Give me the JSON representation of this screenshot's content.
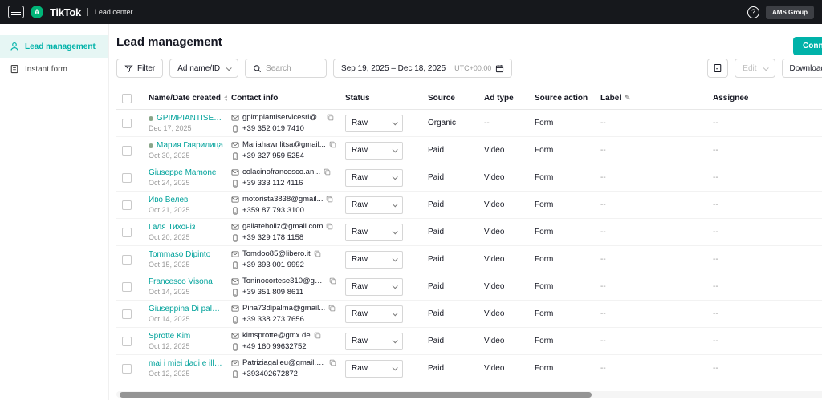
{
  "colors": {
    "accent": "#00b2a9",
    "accent_light_bg": "#e6f6f4",
    "avatar_green": "#00b578",
    "topbar_bg": "#16181c"
  },
  "icons": {
    "help": "?",
    "edit_pencil": "✎"
  },
  "topbar": {
    "brand": "TikTok",
    "product": "Lead center",
    "avatar_letter": "A",
    "org_button_label": "AMS Group"
  },
  "sidebar": {
    "items": [
      {
        "label": "Lead management"
      },
      {
        "label": "Instant form"
      }
    ]
  },
  "main": {
    "title": "Lead management",
    "connect_button_label": "Connect"
  },
  "toolbar": {
    "filter_label": "Filter",
    "ad_dropdown_label": "Ad name/ID",
    "search_placeholder": "Search",
    "date_range": "Sep 19, 2025 – Dec 18, 2025",
    "timezone": "UTC+00:00",
    "edit_label": "Edit",
    "download_label": "Download"
  },
  "table": {
    "headers": {
      "name": "Name/Date created",
      "contact": "Contact info",
      "status": "Status",
      "source": "Source",
      "ad_type": "Ad type",
      "source_action": "Source action",
      "label": "Label",
      "assignee": "Assignee"
    },
    "rows": [
      {
        "name": "GPIMPIANTISERVICE.SRL",
        "date": "Dec 17, 2025",
        "is_new": true,
        "email": "gpimpiantiservicesrl@...",
        "phone": "+39 352 019 7410",
        "status": "Raw",
        "source": "Organic",
        "ad_type": "--",
        "source_action": "Form",
        "label": "--",
        "assignee": "--"
      },
      {
        "name": "Мария Гаврилица",
        "date": "Oct 30, 2025",
        "is_new": true,
        "email": "Mariahawrilitsa@gmail...",
        "phone": "+39 327 959 5254",
        "status": "Raw",
        "source": "Paid",
        "ad_type": "Video",
        "source_action": "Form",
        "label": "--",
        "assignee": "--"
      },
      {
        "name": "Giuseppe Mamone",
        "date": "Oct 24, 2025",
        "is_new": false,
        "email": "colacinofrancesco.an...",
        "phone": "+39 333 112 4116",
        "status": "Raw",
        "source": "Paid",
        "ad_type": "Video",
        "source_action": "Form",
        "label": "--",
        "assignee": "--"
      },
      {
        "name": "Иво Велев",
        "date": "Oct 21, 2025",
        "is_new": false,
        "email": "motorista3838@gmail...",
        "phone": "+359 87 793 3100",
        "status": "Raw",
        "source": "Paid",
        "ad_type": "Video",
        "source_action": "Form",
        "label": "--",
        "assignee": "--"
      },
      {
        "name": "Галя Тихоніз",
        "date": "Oct 20, 2025",
        "is_new": false,
        "email": "galiateholiz@gmail.com",
        "phone": "+39 329 178 1158",
        "status": "Raw",
        "source": "Paid",
        "ad_type": "Video",
        "source_action": "Form",
        "label": "--",
        "assignee": "--"
      },
      {
        "name": "Tommaso Dipinto",
        "date": "Oct 15, 2025",
        "is_new": false,
        "email": "Tomdoo85@libero.it",
        "phone": "+39 393 001 9992",
        "status": "Raw",
        "source": "Paid",
        "ad_type": "Video",
        "source_action": "Form",
        "label": "--",
        "assignee": "--"
      },
      {
        "name": "Francesco Visona",
        "date": "Oct 14, 2025",
        "is_new": false,
        "email": "Toninocortese310@gm...",
        "phone": "+39 351 809 8611",
        "status": "Raw",
        "source": "Paid",
        "ad_type": "Video",
        "source_action": "Form",
        "label": "--",
        "assignee": "--"
      },
      {
        "name": "Giuseppina Di palma",
        "date": "Oct 14, 2025",
        "is_new": false,
        "email": "Pina73dipalma@gmail...",
        "phone": "+39 338 273 7656",
        "status": "Raw",
        "source": "Paid",
        "ad_type": "Video",
        "source_action": "Form",
        "label": "--",
        "assignee": "--"
      },
      {
        "name": "Sprotte Kim",
        "date": "Oct 12, 2025",
        "is_new": false,
        "email": "kimsprotte@gmx.de",
        "phone": "+49 160 99632752",
        "status": "Raw",
        "source": "Paid",
        "ad_type": "Video",
        "source_action": "Form",
        "label": "--",
        "assignee": "--"
      },
      {
        "name": "mai i miei dadi e illegittimo",
        "date": "Oct 12, 2025",
        "is_new": false,
        "email": "Patriziagalleu@gmail.c...",
        "phone": "+393402672872",
        "status": "Raw",
        "source": "Paid",
        "ad_type": "Video",
        "source_action": "Form",
        "label": "--",
        "assignee": "--"
      }
    ]
  }
}
